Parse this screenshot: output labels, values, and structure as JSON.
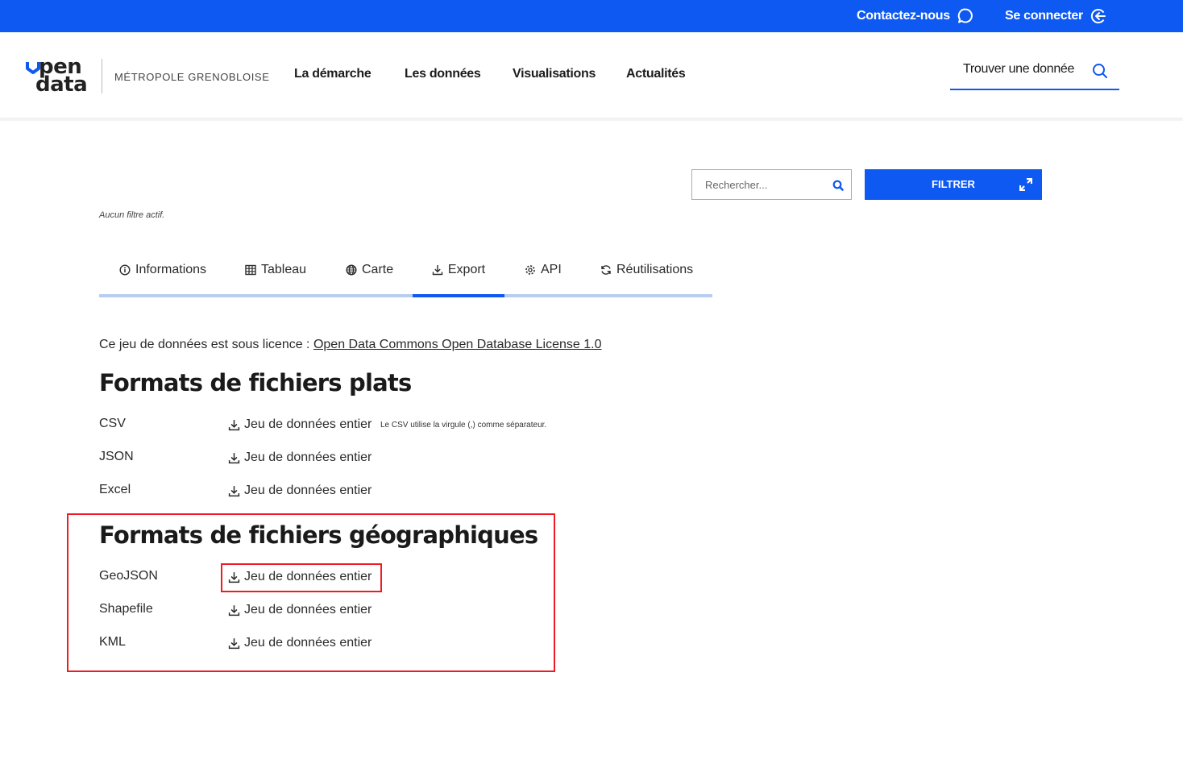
{
  "topbar": {
    "contact_label": "Contactez-nous",
    "contact_icon": "chat-bubble-icon",
    "login_label": "Se connecter",
    "login_icon": "login-arrow-icon",
    "background_color": "#0d59f2"
  },
  "header": {
    "logo_line1": "pen",
    "logo_line2": "data",
    "logo_subtitle": "MÉTROPOLE GRENOBLOISE",
    "nav": [
      {
        "label": "La démarche"
      },
      {
        "label": "Les données"
      },
      {
        "label": "Visualisations"
      },
      {
        "label": "Actualités"
      }
    ],
    "find_label": "Trouver une donnée",
    "find_icon": "search-icon"
  },
  "filters": {
    "search_placeholder": "Rechercher...",
    "search_value": "",
    "filter_button_label": "FILTRER",
    "filter_button_icon": "expand-arrows-icon",
    "active_filters_text": "Aucun filtre actif."
  },
  "tabs": [
    {
      "label": "Informations",
      "icon": "info-circle-icon",
      "active": false
    },
    {
      "label": "Tableau",
      "icon": "table-grid-icon",
      "active": false
    },
    {
      "label": "Carte",
      "icon": "globe-icon",
      "active": false
    },
    {
      "label": "Export",
      "icon": "download-icon",
      "active": true
    },
    {
      "label": "API",
      "icon": "gear-icon",
      "active": false
    },
    {
      "label": "Réutilisations",
      "icon": "refresh-icon",
      "active": false
    }
  ],
  "export": {
    "licence_prefix": "Ce jeu de données est sous licence :",
    "licence_link": "Open Data Commons Open Database License 1.0",
    "flat_title": "Formats de fichiers plats",
    "flat_formats": [
      {
        "format": "CSV",
        "link": "Jeu de données entier",
        "note": "Le CSV utilise la virgule (,) comme séparateur."
      },
      {
        "format": "JSON",
        "link": "Jeu de données entier"
      },
      {
        "format": "Excel",
        "link": "Jeu de données entier"
      }
    ],
    "geo_title": "Formats de fichiers géographiques",
    "geo_formats": [
      {
        "format": "GeoJSON",
        "link": "Jeu de données entier",
        "highlighted": true
      },
      {
        "format": "Shapefile",
        "link": "Jeu de données entier"
      },
      {
        "format": "KML",
        "link": "Jeu de données entier"
      }
    ]
  },
  "colors": {
    "accent": "#0d59f2",
    "tab_track": "#b8cdef",
    "highlight": "#ee1b24"
  }
}
